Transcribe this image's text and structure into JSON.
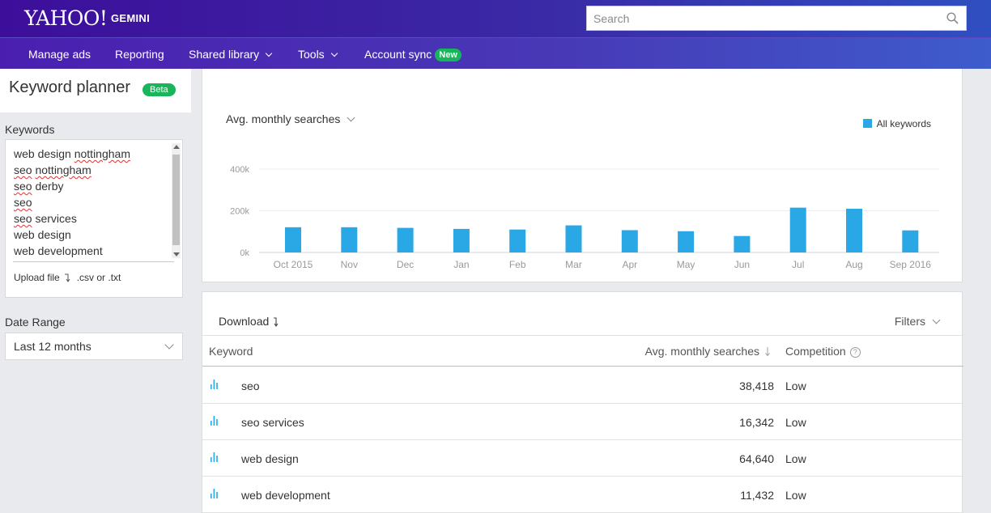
{
  "header": {
    "logo": "YAHOO!",
    "product": "GEMINI",
    "search_placeholder": "Search",
    "search_icon": "search-icon"
  },
  "nav": {
    "items": [
      {
        "label": "Manage ads",
        "dropdown": false
      },
      {
        "label": "Reporting",
        "dropdown": false
      },
      {
        "label": "Shared library",
        "dropdown": true
      },
      {
        "label": "Tools",
        "dropdown": true
      },
      {
        "label": "Account sync",
        "dropdown": false,
        "badge": "New"
      }
    ]
  },
  "sidebar": {
    "title": "Keyword planner",
    "title_badge": "Beta",
    "keywords_label": "Keywords",
    "keyword_lines": [
      {
        "parts": [
          {
            "t": "web design ",
            "sp": false
          },
          {
            "t": "nottingham",
            "sp": true
          }
        ]
      },
      {
        "parts": [
          {
            "t": "seo",
            "sp": true
          },
          {
            "t": " ",
            "sp": false
          },
          {
            "t": "nottingham",
            "sp": true
          }
        ]
      },
      {
        "parts": [
          {
            "t": "seo",
            "sp": true
          },
          {
            "t": " derby",
            "sp": false
          }
        ]
      },
      {
        "parts": [
          {
            "t": "seo",
            "sp": true
          }
        ]
      },
      {
        "parts": [
          {
            "t": "seo",
            "sp": true
          },
          {
            "t": " services",
            "sp": false
          }
        ]
      },
      {
        "parts": [
          {
            "t": "web design",
            "sp": false
          }
        ]
      },
      {
        "parts": [
          {
            "t": "web development",
            "sp": false
          }
        ]
      }
    ],
    "upload_label": "Upload file",
    "upload_formats": ".csv or .txt",
    "date_range_label": "Date Range",
    "date_range_value": "Last 12 months"
  },
  "chart": {
    "metric_label": "Avg. monthly searches",
    "legend_label": "All keywords"
  },
  "chart_data": {
    "type": "bar",
    "categories": [
      "Oct 2015",
      "Nov",
      "Dec",
      "Jan",
      "Feb",
      "Mar",
      "Apr",
      "May",
      "Jun",
      "Jul",
      "Aug",
      "Sep 2016"
    ],
    "series": [
      {
        "name": "All keywords",
        "values": [
          121000,
          121000,
          118000,
          113000,
          110000,
          130000,
          107000,
          102000,
          79000,
          215000,
          210000,
          106000
        ]
      }
    ],
    "y_ticks": [
      {
        "value": 0,
        "label": "0k"
      },
      {
        "value": 200000,
        "label": "200k"
      },
      {
        "value": 400000,
        "label": "400k"
      }
    ],
    "ylim": [
      0,
      400000
    ],
    "color": "#2aa8e6",
    "legend": "top-right",
    "grid": true
  },
  "table": {
    "download_label": "Download",
    "filters_label": "Filters",
    "col_keyword": "Keyword",
    "col_searches": "Avg. monthly searches",
    "col_competition": "Competition",
    "rows": [
      {
        "keyword": "seo",
        "searches": "38,418",
        "competition": "Low"
      },
      {
        "keyword": "seo services",
        "searches": "16,342",
        "competition": "Low"
      },
      {
        "keyword": "web design",
        "searches": "64,640",
        "competition": "Low"
      },
      {
        "keyword": "web development",
        "searches": "11,432",
        "competition": "Low"
      }
    ]
  }
}
